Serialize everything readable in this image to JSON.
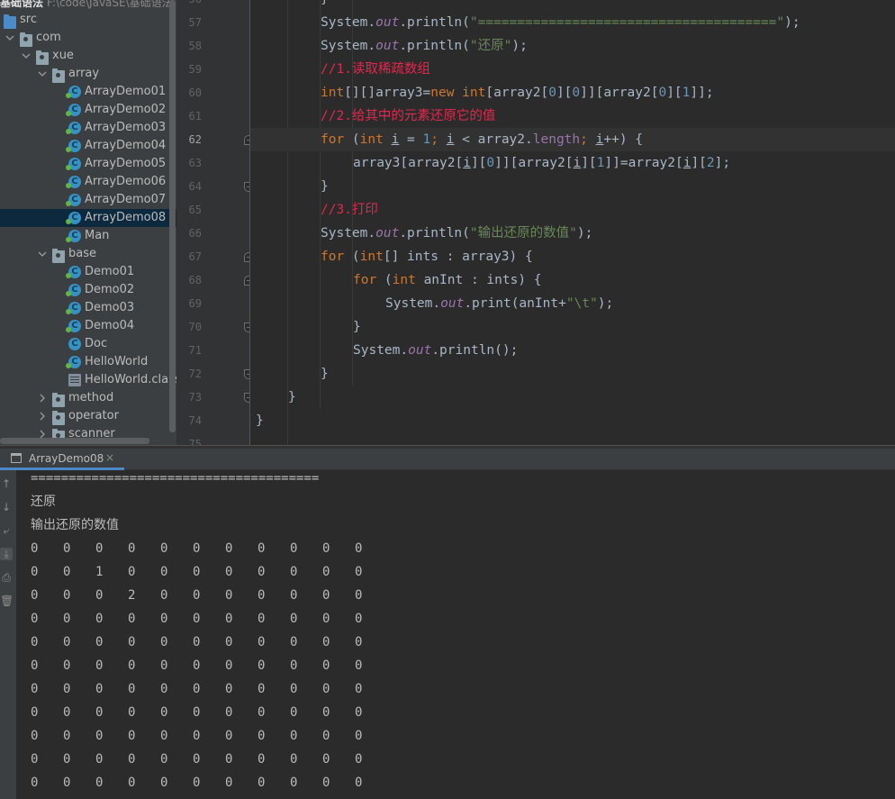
{
  "project": {
    "title": "基础语法",
    "path": "F:\\code\\JavaSE\\基础语法",
    "tree": [
      {
        "label": "src",
        "type": "src-folder",
        "depth": 0,
        "arrow": "none"
      },
      {
        "label": "com",
        "type": "package",
        "depth": 0,
        "arrow": "down"
      },
      {
        "label": "xue",
        "type": "package",
        "depth": 1,
        "arrow": "down"
      },
      {
        "label": "array",
        "type": "package",
        "depth": 2,
        "arrow": "down"
      },
      {
        "label": "ArrayDemo01",
        "type": "class",
        "depth": 3,
        "arrow": "none"
      },
      {
        "label": "ArrayDemo02",
        "type": "class",
        "depth": 3,
        "arrow": "none"
      },
      {
        "label": "ArrayDemo03",
        "type": "class",
        "depth": 3,
        "arrow": "none"
      },
      {
        "label": "ArrayDemo04",
        "type": "class",
        "depth": 3,
        "arrow": "none"
      },
      {
        "label": "ArrayDemo05",
        "type": "class",
        "depth": 3,
        "arrow": "none"
      },
      {
        "label": "ArrayDemo06",
        "type": "class",
        "depth": 3,
        "arrow": "none"
      },
      {
        "label": "ArrayDemo07",
        "type": "class",
        "depth": 3,
        "arrow": "none"
      },
      {
        "label": "ArrayDemo08",
        "type": "class",
        "depth": 3,
        "arrow": "none",
        "selected": true
      },
      {
        "label": "Man",
        "type": "class",
        "depth": 3,
        "arrow": "none"
      },
      {
        "label": "base",
        "type": "package",
        "depth": 2,
        "arrow": "down"
      },
      {
        "label": "Demo01",
        "type": "class",
        "depth": 3,
        "arrow": "none"
      },
      {
        "label": "Demo02",
        "type": "class",
        "depth": 3,
        "arrow": "none"
      },
      {
        "label": "Demo03",
        "type": "class",
        "depth": 3,
        "arrow": "none"
      },
      {
        "label": "Demo04",
        "type": "class",
        "depth": 3,
        "arrow": "none"
      },
      {
        "label": "Doc",
        "type": "class-plain",
        "depth": 3,
        "arrow": "none"
      },
      {
        "label": "HelloWorld",
        "type": "class",
        "depth": 3,
        "arrow": "none"
      },
      {
        "label": "HelloWorld.class",
        "type": "class-file",
        "depth": 3,
        "arrow": "none"
      },
      {
        "label": "method",
        "type": "package",
        "depth": 2,
        "arrow": "right"
      },
      {
        "label": "operator",
        "type": "package",
        "depth": 2,
        "arrow": "right"
      },
      {
        "label": "scanner",
        "type": "package",
        "depth": 2,
        "arrow": "right"
      }
    ]
  },
  "editor": {
    "current_line": 62,
    "lines": [
      {
        "num": "56",
        "indent": 2,
        "fold": "",
        "tokens": [
          [
            "gray",
            "}"
          ]
        ]
      },
      {
        "num": "57",
        "indent": 2,
        "fold": "",
        "tokens": [
          [
            "gray",
            "System."
          ],
          [
            "fld",
            "out"
          ],
          [
            "gray",
            ".println("
          ],
          [
            "str",
            "\"======================================\""
          ],
          [
            "gray",
            ");"
          ]
        ]
      },
      {
        "num": "58",
        "indent": 2,
        "fold": "",
        "tokens": [
          [
            "gray",
            "System."
          ],
          [
            "fld",
            "out"
          ],
          [
            "gray",
            ".println("
          ],
          [
            "str",
            "\"还原\""
          ],
          [
            "gray",
            ");"
          ]
        ]
      },
      {
        "num": "59",
        "indent": 2,
        "fold": "",
        "tokens": [
          [
            "cmt",
            "//1.读取稀疏数组"
          ]
        ]
      },
      {
        "num": "60",
        "indent": 2,
        "fold": "",
        "tokens": [
          [
            "kw",
            "int"
          ],
          [
            "gray",
            "[][]array3="
          ],
          [
            "kw",
            "new "
          ],
          [
            "kw",
            "int"
          ],
          [
            "gray",
            "[array2["
          ],
          [
            "num",
            "0"
          ],
          [
            "gray",
            "]["
          ],
          [
            "num",
            "0"
          ],
          [
            "gray",
            "]][array2["
          ],
          [
            "num",
            "0"
          ],
          [
            "gray",
            "]["
          ],
          [
            "num",
            "1"
          ],
          [
            "gray",
            "]];"
          ]
        ]
      },
      {
        "num": "61",
        "indent": 2,
        "fold": "",
        "tokens": [
          [
            "cmt",
            "//2.给其中的元素还原它的值"
          ]
        ]
      },
      {
        "num": "62",
        "indent": 2,
        "fold": "open",
        "tokens": [
          [
            "kw",
            "for "
          ],
          [
            "gray",
            "("
          ],
          [
            "kw",
            "int "
          ],
          [
            "ul",
            "i"
          ],
          [
            "gray",
            " = "
          ],
          [
            "num",
            "1"
          ],
          [
            "kw",
            "; "
          ],
          [
            "ul",
            "i"
          ],
          [
            "gray",
            " < array2."
          ],
          [
            "fldp",
            "length"
          ],
          [
            "kw",
            "; "
          ],
          [
            "ul",
            "i"
          ],
          [
            "gray",
            "++) {"
          ]
        ]
      },
      {
        "num": "63",
        "indent": 3,
        "fold": "",
        "tokens": [
          [
            "gray",
            "array3[array2["
          ],
          [
            "ul",
            "i"
          ],
          [
            "gray",
            "]["
          ],
          [
            "num",
            "0"
          ],
          [
            "gray",
            "]][array2["
          ],
          [
            "ul",
            "i"
          ],
          [
            "gray",
            "]["
          ],
          [
            "num",
            "1"
          ],
          [
            "gray",
            "]]=array2["
          ],
          [
            "ul",
            "i"
          ],
          [
            "gray",
            "]["
          ],
          [
            "num",
            "2"
          ],
          [
            "gray",
            "];"
          ]
        ]
      },
      {
        "num": "64",
        "indent": 2,
        "fold": "close",
        "tokens": [
          [
            "gray",
            "}"
          ]
        ]
      },
      {
        "num": "65",
        "indent": 2,
        "fold": "",
        "tokens": [
          [
            "cmt",
            "//3.打印"
          ]
        ]
      },
      {
        "num": "66",
        "indent": 2,
        "fold": "",
        "tokens": [
          [
            "gray",
            "System."
          ],
          [
            "fld",
            "out"
          ],
          [
            "gray",
            ".println("
          ],
          [
            "str",
            "\"输出还原的数值\""
          ],
          [
            "gray",
            ");"
          ]
        ]
      },
      {
        "num": "67",
        "indent": 2,
        "fold": "open",
        "tokens": [
          [
            "kw",
            "for "
          ],
          [
            "gray",
            "("
          ],
          [
            "kw",
            "int"
          ],
          [
            "gray",
            "[] ints : array3) {"
          ]
        ]
      },
      {
        "num": "68",
        "indent": 3,
        "fold": "open",
        "tokens": [
          [
            "kw",
            "for "
          ],
          [
            "gray",
            "("
          ],
          [
            "kw",
            "int "
          ],
          [
            "gray",
            "anInt : ints) {"
          ]
        ]
      },
      {
        "num": "69",
        "indent": 4,
        "fold": "",
        "tokens": [
          [
            "gray",
            "System."
          ],
          [
            "fld",
            "out"
          ],
          [
            "gray",
            ".print(anInt+"
          ],
          [
            "str",
            "\"\\t\""
          ],
          [
            "gray",
            ");"
          ]
        ]
      },
      {
        "num": "70",
        "indent": 3,
        "fold": "close",
        "tokens": [
          [
            "gray",
            "}"
          ]
        ]
      },
      {
        "num": "71",
        "indent": 3,
        "fold": "",
        "tokens": [
          [
            "gray",
            "System."
          ],
          [
            "fld",
            "out"
          ],
          [
            "gray",
            ".println();"
          ]
        ]
      },
      {
        "num": "72",
        "indent": 2,
        "fold": "close",
        "tokens": [
          [
            "gray",
            "}"
          ]
        ]
      },
      {
        "num": "73",
        "indent": 1,
        "fold": "close",
        "tokens": [
          [
            "gray",
            "}"
          ]
        ]
      },
      {
        "num": "74",
        "indent": 0,
        "fold": "",
        "tokens": [
          [
            "gray",
            "}"
          ]
        ]
      },
      {
        "num": "75",
        "indent": 0,
        "fold": "",
        "tokens": []
      }
    ]
  },
  "run": {
    "tab_label": "ArrayDemo08",
    "close_glyph": "×",
    "toolbar": [
      "↑",
      "↓",
      "⤶",
      "⤓",
      "⎙",
      "🗑"
    ],
    "output_lines": [
      "======================================",
      "还原",
      "输出还原的数值"
    ],
    "matrix": [
      [
        "0",
        "0",
        "0",
        "0",
        "0",
        "0",
        "0",
        "0",
        "0",
        "0",
        "0"
      ],
      [
        "0",
        "0",
        "1",
        "0",
        "0",
        "0",
        "0",
        "0",
        "0",
        "0",
        "0"
      ],
      [
        "0",
        "0",
        "0",
        "2",
        "0",
        "0",
        "0",
        "0",
        "0",
        "0",
        "0"
      ],
      [
        "0",
        "0",
        "0",
        "0",
        "0",
        "0",
        "0",
        "0",
        "0",
        "0",
        "0"
      ],
      [
        "0",
        "0",
        "0",
        "0",
        "0",
        "0",
        "0",
        "0",
        "0",
        "0",
        "0"
      ],
      [
        "0",
        "0",
        "0",
        "0",
        "0",
        "0",
        "0",
        "0",
        "0",
        "0",
        "0"
      ],
      [
        "0",
        "0",
        "0",
        "0",
        "0",
        "0",
        "0",
        "0",
        "0",
        "0",
        "0"
      ],
      [
        "0",
        "0",
        "0",
        "0",
        "0",
        "0",
        "0",
        "0",
        "0",
        "0",
        "0"
      ],
      [
        "0",
        "0",
        "0",
        "0",
        "0",
        "0",
        "0",
        "0",
        "0",
        "0",
        "0"
      ],
      [
        "0",
        "0",
        "0",
        "0",
        "0",
        "0",
        "0",
        "0",
        "0",
        "0",
        "0"
      ],
      [
        "0",
        "0",
        "0",
        "0",
        "0",
        "0",
        "0",
        "0",
        "0",
        "0",
        "0"
      ]
    ]
  }
}
